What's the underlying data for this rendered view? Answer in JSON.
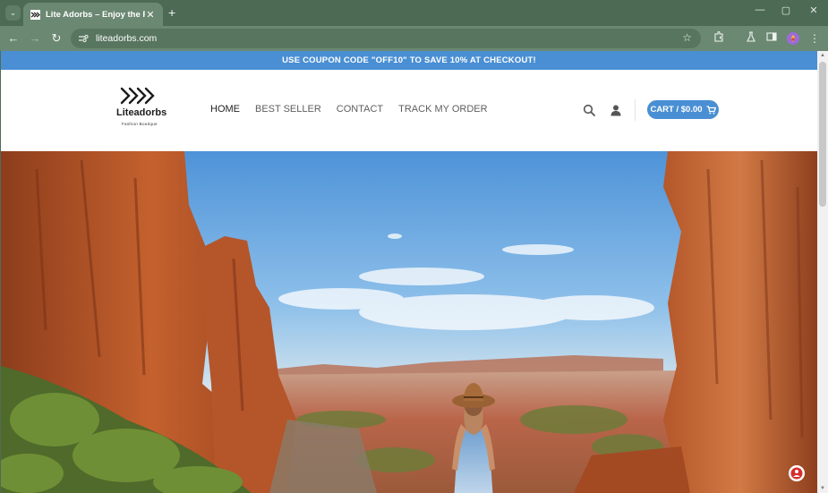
{
  "browser": {
    "tab_title": "Lite Adorbs – Enjoy the Ride!",
    "url": "liteadorbs.com",
    "icons": [
      "tab-search-icon",
      "favicon-icon",
      "close-icon",
      "new-tab-icon",
      "minimize-icon",
      "maximize-icon",
      "window-close-icon",
      "back-icon",
      "forward-icon",
      "reload-icon",
      "site-info-icon",
      "bookmark-star-icon",
      "extensions-icon",
      "labs-icon",
      "side-panel-icon",
      "profile-icon",
      "menu-icon"
    ]
  },
  "promo": {
    "text": "USE COUPON CODE \"OFF10\" TO SAVE 10% AT CHECKOUT!"
  },
  "header": {
    "logo_name": "Liteadorbs",
    "logo_tagline": "Fashion Boutique",
    "nav": [
      {
        "label": "HOME",
        "active": true
      },
      {
        "label": "BEST SELLER",
        "active": false
      },
      {
        "label": "CONTACT",
        "active": false
      },
      {
        "label": "TRACK MY ORDER",
        "active": false
      }
    ],
    "cart_label": "CART / $0.00"
  },
  "colors": {
    "browser_frame": "#4d6a55",
    "toolbar": "#6b8872",
    "accent": "#4a8fd3"
  }
}
